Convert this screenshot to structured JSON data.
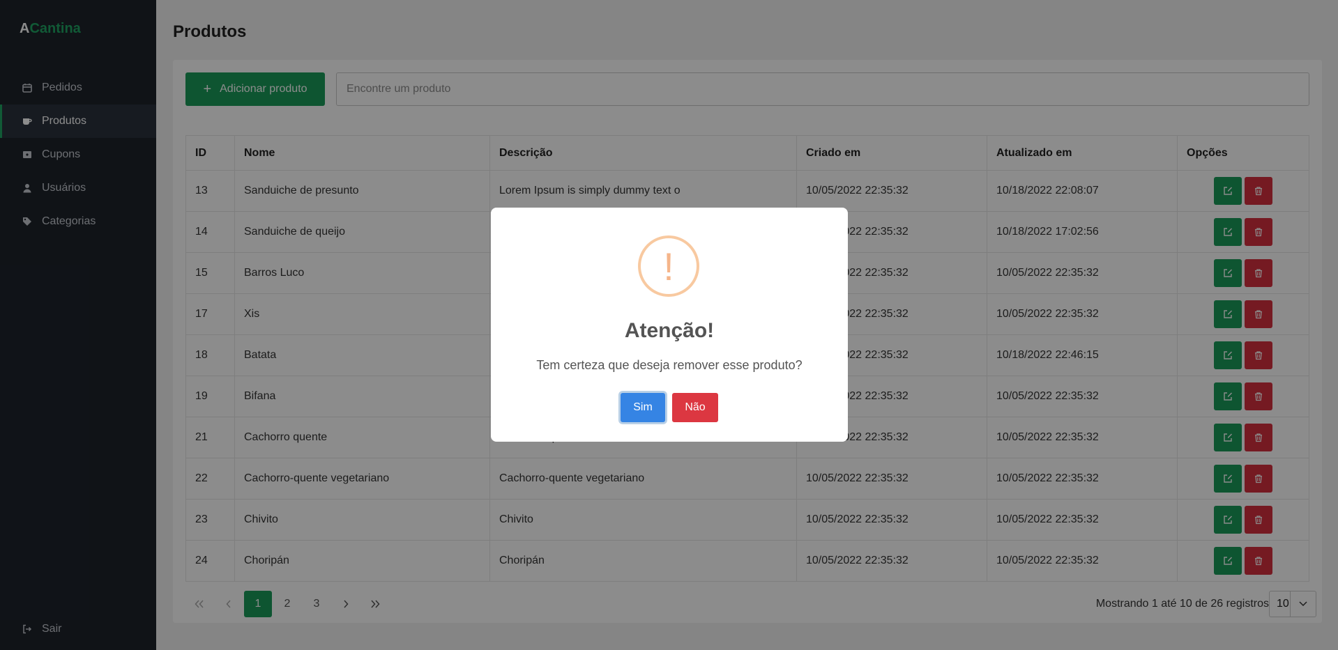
{
  "brand": {
    "a": "A",
    "rest": "Cantina"
  },
  "sidebar": {
    "items": [
      {
        "label": "Pedidos",
        "icon": "calendar-icon"
      },
      {
        "label": "Produtos",
        "icon": "coffee-icon"
      },
      {
        "label": "Cupons",
        "icon": "ticket-icon"
      },
      {
        "label": "Usuários",
        "icon": "user-icon"
      },
      {
        "label": "Categorias",
        "icon": "tag-icon"
      }
    ],
    "active": "Produtos",
    "logout": "Sair"
  },
  "page": {
    "title": "Produtos"
  },
  "toolbar": {
    "add_label": "Adicionar produto",
    "search_placeholder": "Encontre um produto"
  },
  "table": {
    "headers": [
      "ID",
      "Nome",
      "Descrição",
      "Criado em",
      "Atualizado em",
      "Opções"
    ],
    "rows": [
      [
        "13",
        "Sanduiche de presunto",
        "Lorem Ipsum is simply dummy text o",
        "10/05/2022 22:35:32",
        "10/18/2022 22:08:07"
      ],
      [
        "14",
        "Sanduiche de queijo",
        "",
        "10/05/2022 22:35:32",
        "10/18/2022 17:02:56"
      ],
      [
        "15",
        "Barros Luco",
        "",
        "10/05/2022 22:35:32",
        "10/05/2022 22:35:32"
      ],
      [
        "17",
        "Xis",
        "",
        "10/05/2022 22:35:32",
        "10/05/2022 22:35:32"
      ],
      [
        "18",
        "Batata",
        "",
        "10/05/2022 22:35:32",
        "10/18/2022 22:46:15"
      ],
      [
        "19",
        "Bifana",
        "",
        "10/05/2022 22:35:32",
        "10/05/2022 22:35:32"
      ],
      [
        "21",
        "Cachorro quente",
        "Cachorro quente",
        "10/05/2022 22:35:32",
        "10/05/2022 22:35:32"
      ],
      [
        "22",
        "Cachorro-quente vegetariano",
        "Cachorro-quente vegetariano",
        "10/05/2022 22:35:32",
        "10/05/2022 22:35:32"
      ],
      [
        "23",
        "Chivito",
        "Chivito",
        "10/05/2022 22:35:32",
        "10/05/2022 22:35:32"
      ],
      [
        "24",
        "Choripán",
        "Choripán",
        "10/05/2022 22:35:32",
        "10/05/2022 22:35:32"
      ]
    ]
  },
  "pagination": {
    "first": "«",
    "prev": "‹",
    "pages": [
      "1",
      "2",
      "3"
    ],
    "current": "1",
    "next": "›",
    "last": "»",
    "showing": "Mostrando 1 até 10 de 26 registros",
    "per_page": "10"
  },
  "modal": {
    "icon": "!",
    "title": "Atenção!",
    "text": "Tem certeza que deseja remover esse produto?",
    "confirm": "Sim",
    "cancel": "Não"
  },
  "colors": {
    "brand_green": "#1a9c5a",
    "danger_red": "#d6313f",
    "sidebar_bg": "#1e232b",
    "confirm_blue": "#3584e4",
    "warning_orange": "#f8c9a0"
  }
}
